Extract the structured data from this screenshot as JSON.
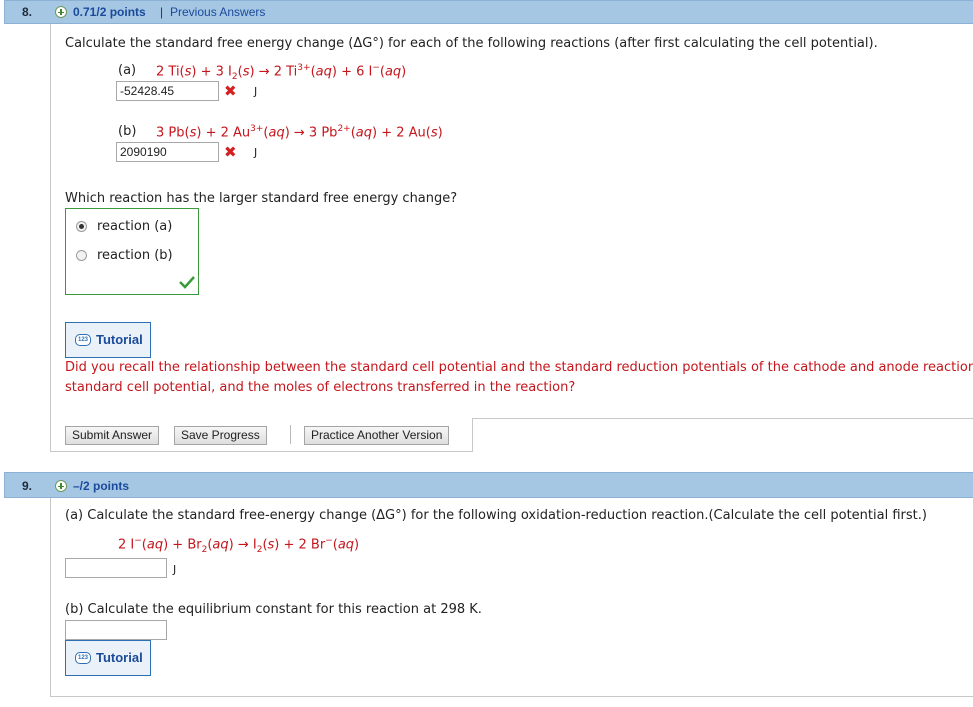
{
  "q8": {
    "number": "8.",
    "points": "0.71/2 points",
    "separator": "|",
    "previous_answers": "Previous Answers",
    "prompt": "Calculate the standard free energy change (ΔG°) for each of the following reactions (after first calculating the cell potential).",
    "part_a": {
      "label": "(a)",
      "reaction_html": "2 Ti(<i>s</i>) + 3 I<sub>2</sub>(<i>s</i>) → 2 Ti<sup>3+</sup>(<i>aq</i>) + 6 I<sup>−</sup>(<i>aq</i>)",
      "answer": "-52428.45",
      "unit": "J"
    },
    "part_b": {
      "label": "(b)",
      "reaction_html": "3 Pb(<i>s</i>) + 2 Au<sup>3+</sup>(<i>aq</i>) → 3 Pb<sup>2+</sup>(<i>aq</i>) + 2 Au(<i>s</i>)",
      "answer": "2090190",
      "unit": "J"
    },
    "mc_question": "Which reaction has the larger standard free energy change?",
    "mc_options": [
      "reaction (a)",
      "reaction (b)"
    ],
    "mc_selected": 0,
    "tutorial_label": "Tutorial",
    "hint_line1": "Did you recall the relationship between the standard cell potential and the standard reduction potentials of the cathode and anode reaction",
    "hint_line2": "standard cell potential, and the moles of electrons transferred in the reaction?",
    "buttons": {
      "submit": "Submit Answer",
      "save": "Save Progress",
      "practice": "Practice Another Version"
    }
  },
  "q9": {
    "number": "9.",
    "points": "–/2 points",
    "prompt_a": "(a) Calculate the standard free-energy change (ΔG°) for the following oxidation-reduction reaction.(Calculate the cell potential first.)",
    "reaction_html": "2 I<sup>−</sup>(<i>aq</i>) + Br<sub>2</sub>(<i>aq</i>) → I<sub>2</sub>(<i>s</i>) + 2 Br<sup>−</sup>(<i>aq</i>)",
    "answer_a": "",
    "unit_a": "J",
    "prompt_b": "(b) Calculate the equilibrium constant for this reaction at 298 K.",
    "answer_b": "",
    "tutorial_label": "Tutorial"
  },
  "icons": {
    "tutorial_icon_text": "123"
  },
  "colors": {
    "header_bg": "#a6c7e4",
    "link": "#1a4a9a",
    "error": "#c4161c",
    "correct_border": "#3b9a3b"
  }
}
